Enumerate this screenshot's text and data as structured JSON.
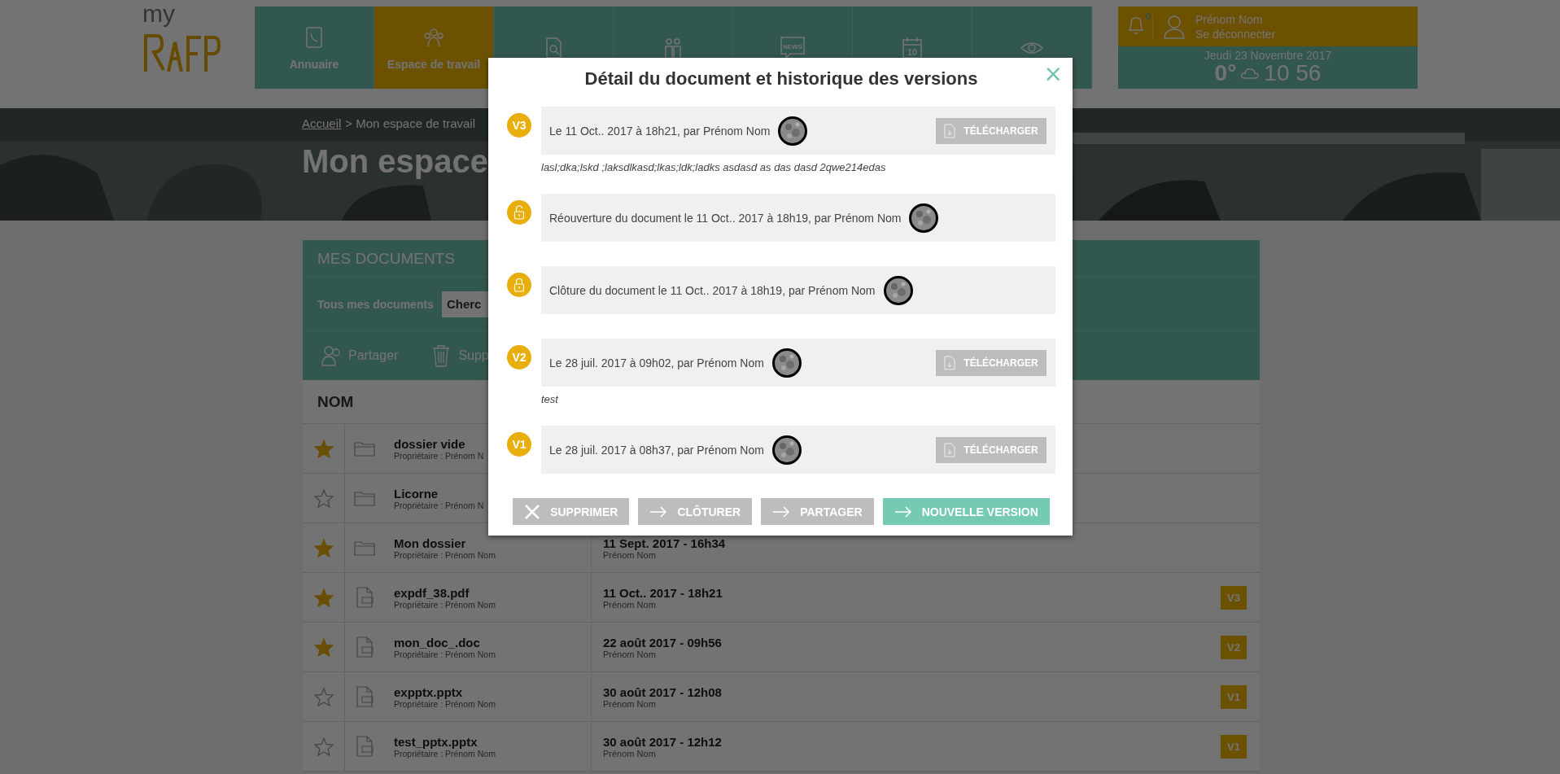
{
  "header": {
    "logo_text": "my",
    "nav": [
      {
        "label": "Annuaire",
        "selected": false
      },
      {
        "label": "Espace de travail",
        "selected": true
      },
      {
        "selected": false
      },
      {
        "selected": false
      },
      {
        "icon_text": "NEWS",
        "selected": false
      },
      {
        "icon_text": "10",
        "selected": false
      },
      {
        "selected": false
      }
    ],
    "notifications": "0",
    "user_name": "Prénom Nom",
    "logout": "Se déconnecter",
    "date": "Jeudi 23 Novembre 2017",
    "temperature": "0°",
    "time": "10 56"
  },
  "hero": {
    "breadcrumb_link": "Accueil",
    "breadcrumb_current": "> Mon espace de travail",
    "title": "Mon espace"
  },
  "documents": {
    "title": "MES DOCUMENTS",
    "filter_label": "Tous mes documents",
    "search_placeholder": "Cherc",
    "actions": [
      {
        "label": "Partager"
      },
      {
        "label": "Supp"
      }
    ],
    "column": "NOM",
    "rows": [
      {
        "starred": true,
        "kind": "folder",
        "name": "dossier vide",
        "owner": "Propriétaire : Prénom N"
      },
      {
        "starred": false,
        "kind": "folder",
        "name": "Licorne",
        "owner": "Propriétaire : Prénom N"
      },
      {
        "starred": true,
        "kind": "folder",
        "name": "Mon dossier",
        "owner": "Propriétaire : Prénom Nom",
        "date": "11 Sept. 2017 - 16h34",
        "author": "Prénom Nom"
      },
      {
        "starred": true,
        "kind": "file",
        "name": "expdf_38.pdf",
        "owner": "Propriétaire : Prénom Nom",
        "date": "11 Oct.. 2017 - 18h21",
        "author": "Prénom Nom",
        "version": "V3"
      },
      {
        "starred": true,
        "kind": "file",
        "name": "mon_doc_.doc",
        "owner": "Propriétaire : Prénom Nom",
        "date": "22 août 2017 - 09h56",
        "author": "Prénom Nom",
        "version": "V2"
      },
      {
        "starred": false,
        "kind": "file",
        "name": "expptx.pptx",
        "owner": "Propriétaire : Prénom Nom",
        "date": "30 août 2017 - 12h08",
        "author": "Prénom Nom",
        "version": "V1"
      },
      {
        "starred": false,
        "kind": "file",
        "name": "test_pptx.pptx",
        "owner": "Propriétaire : Prénom Nom",
        "date": "30 août 2017 - 12h12",
        "author": "Prénom Nom",
        "version": "V1"
      }
    ]
  },
  "modal": {
    "title": "Détail du document et historique des versions",
    "close": "×",
    "entries": [
      {
        "kind": "version",
        "badge": "V3",
        "text": "Le 11 Oct.. 2017 à 18h21, par Prénom Nom",
        "download": "TÉLÉCHARGER",
        "comment": "lasl;dka;lskd ;laksdlkasd;lkas;ldk;ladks asdasd as das dasd 2qwe214edas"
      },
      {
        "kind": "unlock",
        "text": "Réouverture du document le 11 Oct.. 2017 à 18h19, par Prénom Nom"
      },
      {
        "kind": "lock",
        "text": "Clôture du document le 11 Oct.. 2017 à 18h19, par Prénom Nom"
      },
      {
        "kind": "version",
        "badge": "V2",
        "text": "Le 28 juil. 2017 à 09h02, par Prénom Nom",
        "download": "TÉLÉCHARGER",
        "comment": "test"
      },
      {
        "kind": "version",
        "badge": "V1",
        "text": "Le 28 juil. 2017 à 08h37, par Prénom Nom",
        "download": "TÉLÉCHARGER"
      }
    ],
    "buttons": [
      {
        "kind": "delete",
        "label": "SUPPRIMER",
        "primary": false
      },
      {
        "kind": "arrow",
        "label": "CLÔTURER",
        "primary": false
      },
      {
        "kind": "arrow",
        "label": "PARTAGER",
        "primary": false
      },
      {
        "kind": "arrow",
        "label": "NOUVELLE VERSION",
        "primary": true
      }
    ]
  }
}
